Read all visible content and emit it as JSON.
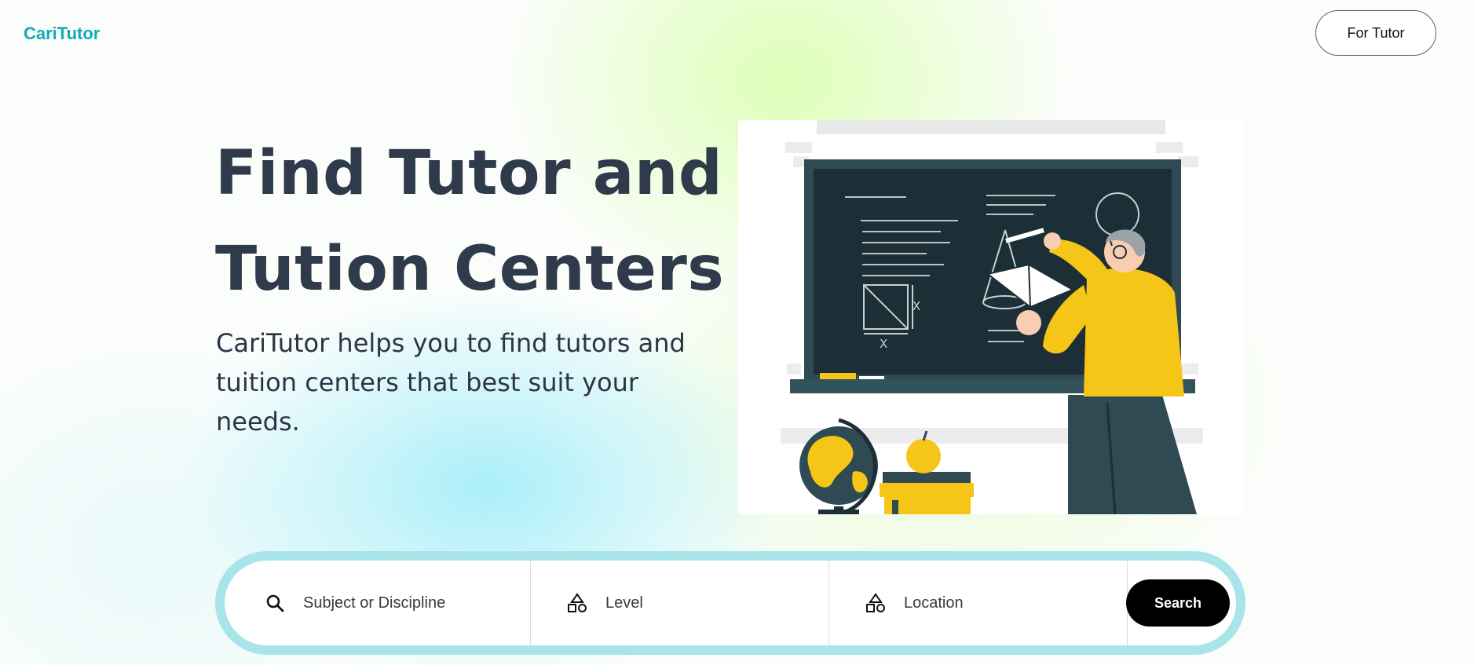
{
  "header": {
    "brand": "CariTutor",
    "for_tutor_label": "For Tutor"
  },
  "hero": {
    "title_line1": "Find Tutor and",
    "title_line2": "Tution Centers",
    "subtitle": "CariTutor helps you to find tutors and tuition centers that best suit your needs.",
    "illustration_icon": "teacher-at-chalkboard-illustration"
  },
  "search": {
    "subject_placeholder": "Subject or Discipline",
    "subject_icon": "search-icon",
    "level_placeholder": "Level",
    "level_icon": "shapes-icon",
    "location_placeholder": "Location",
    "location_icon": "shapes-icon",
    "button_label": "Search"
  },
  "colors": {
    "brand": "#14a9b8",
    "title_text": "#2f3a4a",
    "search_ring": "#a9e4ea",
    "search_button": "#000000",
    "chalkboard": "#1c2e36",
    "accent_yellow": "#f5c518"
  }
}
